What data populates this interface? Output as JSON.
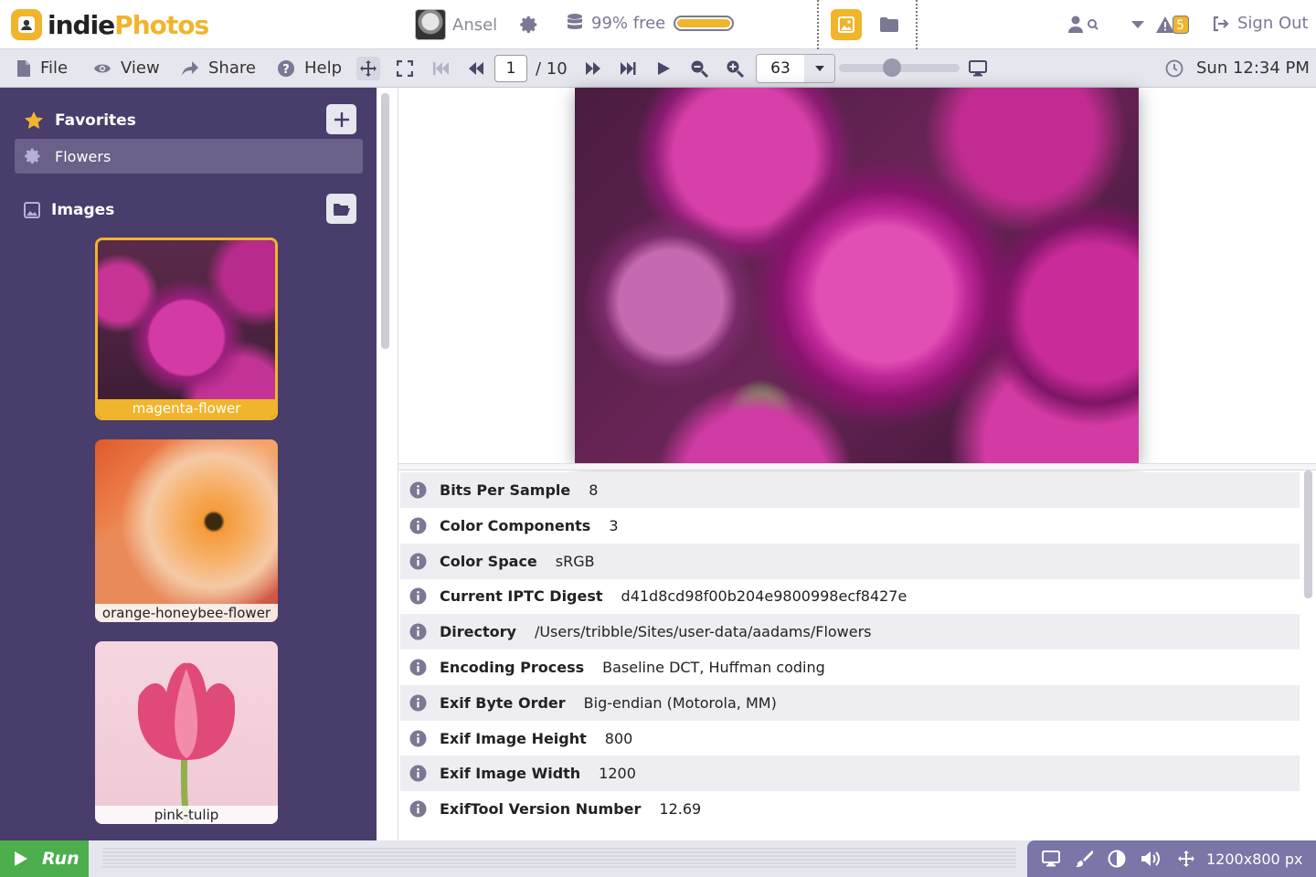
{
  "app": {
    "name_part1": "indie",
    "name_part2": "Photos"
  },
  "header": {
    "user_name": "Ansel",
    "storage_label": "99% free",
    "storage_free_fraction": 0.99,
    "notification_badge": "5",
    "sign_out_label": "Sign Out"
  },
  "menu": {
    "file": "File",
    "view": "View",
    "share": "Share",
    "help": "Help"
  },
  "pager": {
    "current_page": "1",
    "total_label": "/ 10"
  },
  "zoom": {
    "value": "63",
    "slider_fraction": 0.44
  },
  "clock": {
    "label": "Sun 12:34 PM"
  },
  "sidebar": {
    "favorites_label": "Favorites",
    "selected_favorite": "Flowers",
    "images_label": "Images",
    "thumbnails": [
      {
        "caption": "magenta-flower"
      },
      {
        "caption": "orange-honeybee-flower"
      },
      {
        "caption": "pink-tulip"
      }
    ]
  },
  "metadata": {
    "rows": [
      {
        "key": "Bits Per Sample",
        "value": "8"
      },
      {
        "key": "Color Components",
        "value": "3"
      },
      {
        "key": "Color Space",
        "value": "sRGB"
      },
      {
        "key": "Current IPTC Digest",
        "value": "d41d8cd98f00b204e9800998ecf8427e"
      },
      {
        "key": "Directory",
        "value": "/Users/tribble/Sites/user-data/aadams/Flowers"
      },
      {
        "key": "Encoding Process",
        "value": "Baseline DCT, Huffman coding"
      },
      {
        "key": "Exif Byte Order",
        "value": "Big-endian (Motorola, MM)"
      },
      {
        "key": "Exif Image Height",
        "value": "800"
      },
      {
        "key": "Exif Image Width",
        "value": "1200"
      },
      {
        "key": "ExifTool Version Number",
        "value": "12.69"
      }
    ]
  },
  "footer": {
    "run_label": "Run",
    "image_size": "1200x800 px"
  },
  "colors": {
    "accent": "#f0b52c",
    "sidebar": "#483d6b",
    "run": "#4cae4c",
    "status": "#7a76a8"
  }
}
